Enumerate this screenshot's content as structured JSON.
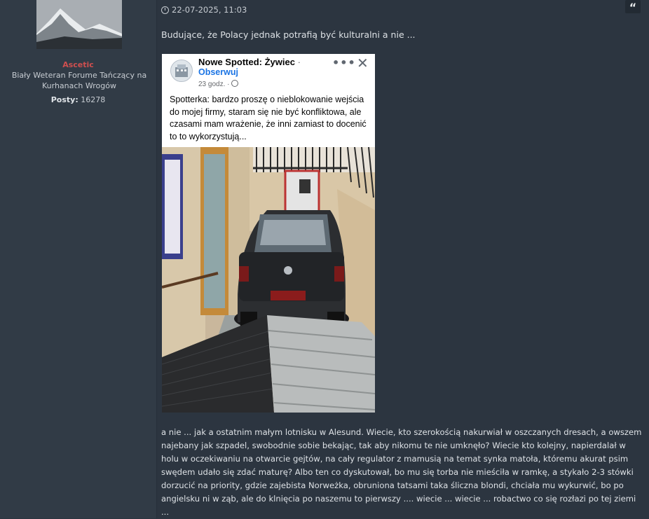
{
  "profile": {
    "username": "Ascetic",
    "rank": "Biały Weteran Forume Tańczący na Kurhanach Wrogów",
    "posts_label": "Posty:",
    "posts_count": "16278"
  },
  "post": {
    "date": "22-07-2025, 11:03",
    "intro": "Budujące, że Polacy jednak potrafią być kulturalni a nie ...",
    "body": "a nie ... jak a ostatnim małym lotnisku w Alesund. Wiecie, kto szerokością nakurwiał w oszczanych dresach, a owszem najebany jak szpadel, swobodnie sobie bekając, tak aby nikomu te nie umknęło? Wiecie kto kolejny, napierdalał w holu w oczekiwaniu na otwarcie gejtów, na cały regulator z mamusią na temat synka matoła, któremu akurat psim swędem udało się zdać maturę? Albo ten co dyskutował, bo mu się torba nie mieściła w ramkę, a stykało 2-3 stówki dorzucić na priority, gdzie zajebista Norweżka, obruniona tatsami taka śliczna blondi, chciała mu wykurwić, bo po angielsku ni w ząb, ale do klnięcia po naszemu to pierwszy .... wiecie ... wiecie ... robactwo co się rozłazi po tej ziemi ..."
  },
  "embed": {
    "page_name": "Nowe Spotted: Żywiec",
    "follow_label": "Obserwuj",
    "time": "23 godz.",
    "post_text": "Spotterka: bardzo proszę o nieblokowanie wejścia do mojej firmy, staram się nie być konfliktowa, ale czasami mam wrażenie, że inni zamiast to docenić to to wykorzystują..."
  },
  "icons": {
    "clock": "clock-icon",
    "quote": "quote-icon",
    "more": "more-dots-icon",
    "close": "close-icon",
    "globe": "globe-icon"
  },
  "colors": {
    "background": "#2c3540",
    "username": "#cf4f4f",
    "link": "#1b74e4"
  }
}
